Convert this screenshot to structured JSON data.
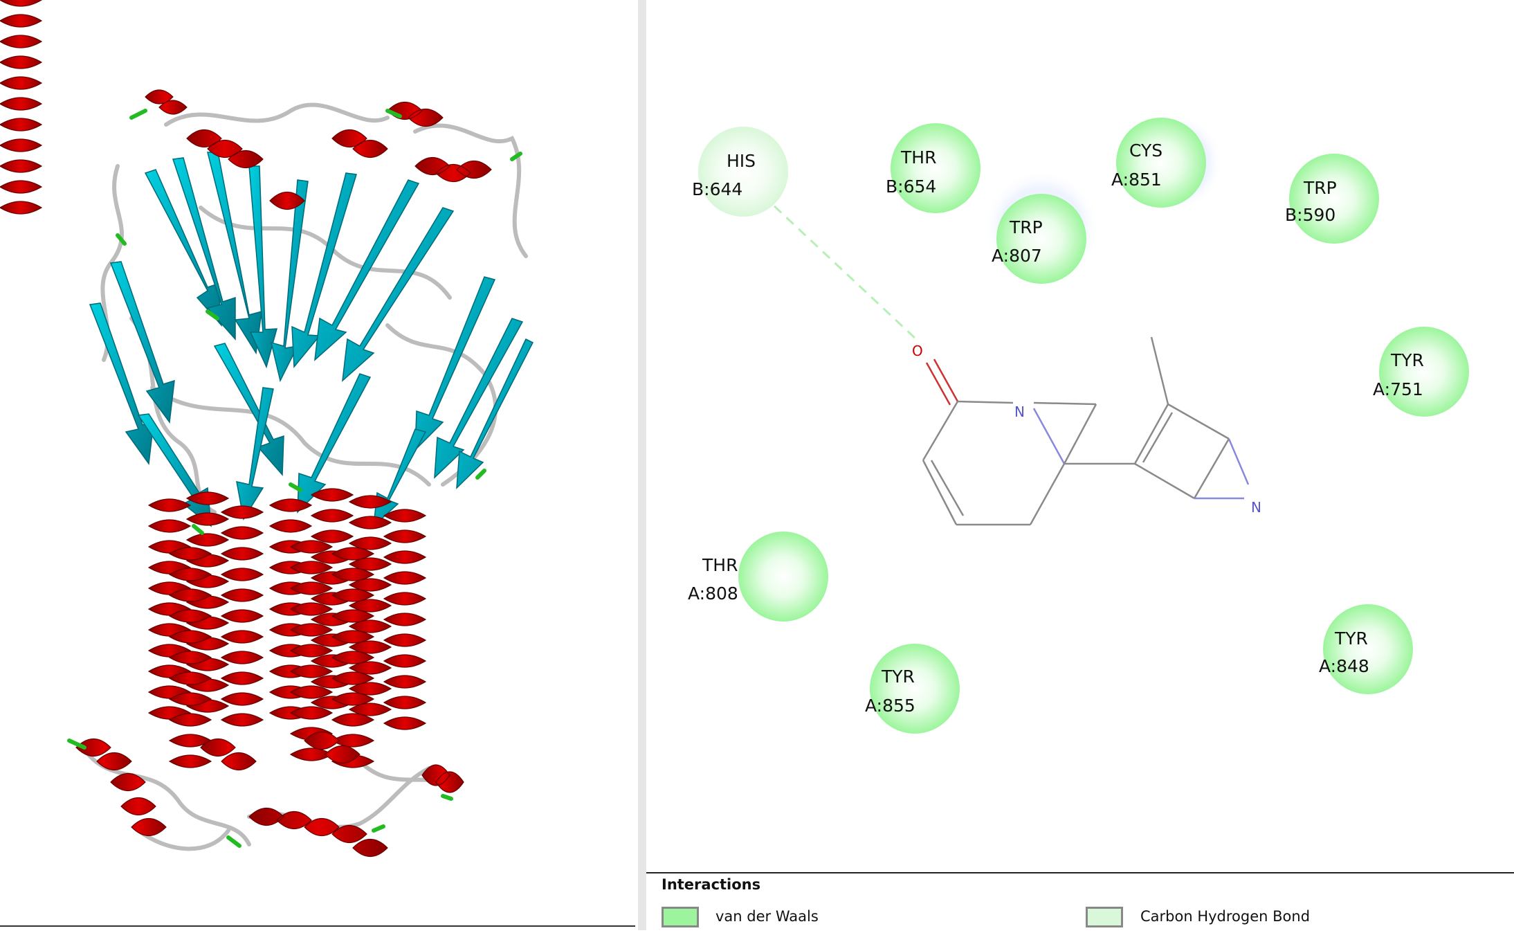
{
  "colors": {
    "helix": "#cc0000",
    "sheet": "#00b3c8",
    "coil": "#b8b8b8",
    "turn": "#22bb22",
    "vdw": "#9cf59c",
    "carbon_h_bond": "#d9f7d9"
  },
  "residues": [
    {
      "name": "HIS",
      "chain": "B:644"
    },
    {
      "name": "THR",
      "chain": "B:654"
    },
    {
      "name": "CYS",
      "chain": "A:851"
    },
    {
      "name": "TRP",
      "chain": "B:590"
    },
    {
      "name": "TRP",
      "chain": "A:807"
    },
    {
      "name": "TYR",
      "chain": "A:751"
    },
    {
      "name": "THR",
      "chain": "A:808"
    },
    {
      "name": "TYR",
      "chain": "A:855"
    },
    {
      "name": "TYR",
      "chain": "A:848"
    }
  ],
  "ligand": {
    "atoms": {
      "oxygen": "O",
      "nitrogen_1": "N",
      "nitrogen_2": "N"
    }
  },
  "legend": {
    "title": "Interactions",
    "items": [
      {
        "label": "van der Waals",
        "color": "#9cf59c"
      },
      {
        "label": "Carbon Hydrogen Bond",
        "color": "#d9f7d9"
      }
    ]
  }
}
